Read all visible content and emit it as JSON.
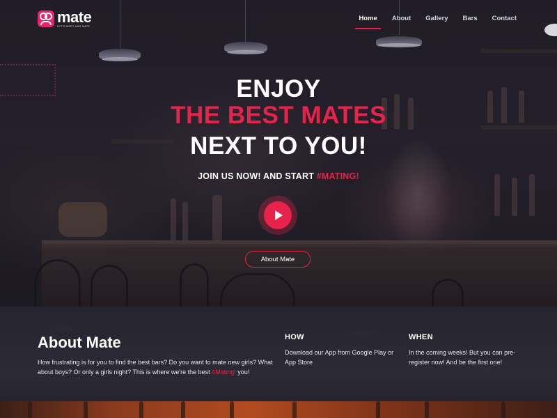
{
  "brand": {
    "name": "mate",
    "tagline": "LET'S MEET AND MATE"
  },
  "nav": {
    "items": [
      "Home",
      "About",
      "Gallery",
      "Bars",
      "Contact"
    ],
    "active": "Home"
  },
  "hero": {
    "line1": "ENJOY",
    "line2": "THE BEST MATES",
    "line3": "NEXT TO YOU!",
    "subline_pre": "JOIN US NOW! AND START ",
    "subline_accent": "#MATING!",
    "cta": "About Mate"
  },
  "about": {
    "title": "About Mate",
    "text_pre": "How frustrating is for you to find the best bars? Do you want to mate new girls? What about boys? Or only a girls night? This is where we're the best ",
    "text_accent": "#Mating!",
    "text_post": " you!",
    "how": {
      "title": "HOW",
      "text": "Download our App from Google Play or App Store"
    },
    "when": {
      "title": "WHEN",
      "text": "In the coming weeks! But you can pre-register now! And be the first one!"
    }
  },
  "colors": {
    "accent": "#e8234b",
    "background": "#25242f"
  },
  "icons": {
    "logo": "mate-logo-icon",
    "play": "play-icon",
    "menu": "menu-icon"
  }
}
